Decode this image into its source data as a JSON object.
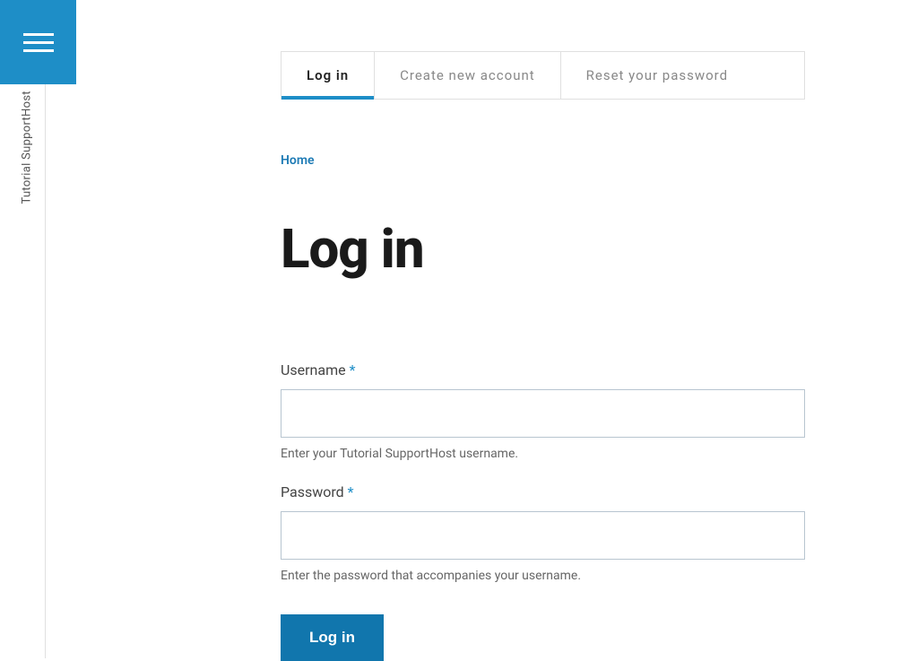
{
  "sidebar": {
    "site_name": "Tutorial SupportHost"
  },
  "tabs": [
    {
      "label": "Log in",
      "active": true
    },
    {
      "label": "Create new account",
      "active": false
    },
    {
      "label": "Reset your password",
      "active": false
    }
  ],
  "breadcrumb": {
    "home": "Home"
  },
  "page": {
    "title": "Log in"
  },
  "form": {
    "username": {
      "label": "Username",
      "required_marker": "*",
      "value": "",
      "help": "Enter your Tutorial SupportHost username."
    },
    "password": {
      "label": "Password",
      "required_marker": "*",
      "value": "",
      "help": "Enter the password that accompanies your username."
    },
    "submit_label": "Log in"
  }
}
